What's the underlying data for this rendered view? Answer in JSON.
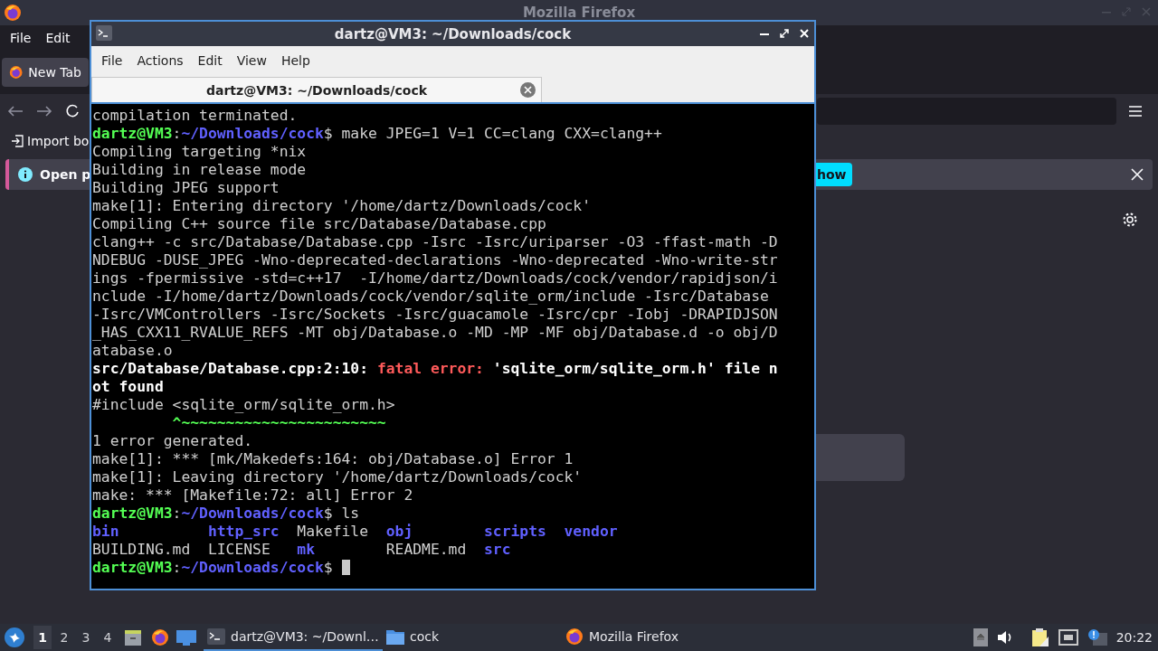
{
  "firefox": {
    "title": "Mozilla Firefox",
    "menu": [
      "File",
      "Edit"
    ],
    "tabs": [
      {
        "label": "New Tab",
        "selected": true
      }
    ],
    "bookmarks_item": "Import bo",
    "notification": {
      "text": "Open p",
      "button": "how"
    }
  },
  "terminal": {
    "title": "dartz@VM3: ~/Downloads/cock",
    "menu": [
      "File",
      "Actions",
      "Edit",
      "View",
      "Help"
    ],
    "tabs": [
      {
        "label": "dartz@VM3: ~/Downloads/cock",
        "selected": true
      }
    ],
    "cursor_visible": true,
    "lines": [
      [
        {
          "text": "compilation terminated.",
          "kind": "plain"
        }
      ],
      [
        {
          "text": "dartz@VM3",
          "kind": "user"
        },
        {
          "text": ":",
          "kind": "plain"
        },
        {
          "text": "~/Downloads/cock",
          "kind": "path"
        },
        {
          "text": "$ make JPEG=1 V=1 CC=clang CXX=clang++",
          "kind": "plain"
        }
      ],
      [
        {
          "text": "Compiling targeting *nix",
          "kind": "plain"
        }
      ],
      [
        {
          "text": "Building in release mode",
          "kind": "plain"
        }
      ],
      [
        {
          "text": "Building JPEG support",
          "kind": "plain"
        }
      ],
      [
        {
          "text": "make[1]: Entering directory '/home/dartz/Downloads/cock'",
          "kind": "plain"
        }
      ],
      [
        {
          "text": "Compiling C++ source file src/Database/Database.cpp",
          "kind": "plain"
        }
      ],
      [
        {
          "text": "clang++ -c src/Database/Database.cpp -Isrc -Isrc/uriparser -O3 -ffast-math -D",
          "kind": "plain"
        }
      ],
      [
        {
          "text": "NDEBUG -DUSE_JPEG -Wno-deprecated-declarations -Wno-deprecated -Wno-write-str",
          "kind": "plain"
        }
      ],
      [
        {
          "text": "ings -fpermissive -std=c++17  -I/home/dartz/Downloads/cock/vendor/rapidjson/i",
          "kind": "plain"
        }
      ],
      [
        {
          "text": "nclude -I/home/dartz/Downloads/cock/vendor/sqlite_orm/include -Isrc/Database",
          "kind": "plain"
        }
      ],
      [
        {
          "text": "-Isrc/VMControllers -Isrc/Sockets -Isrc/guacamole -Isrc/cpr -Iobj -DRAPIDJSON",
          "kind": "plain"
        }
      ],
      [
        {
          "text": "_HAS_CXX11_RVALUE_REFS -MT obj/Database.o -MD -MP -MF obj/Database.d -o obj/D",
          "kind": "plain"
        }
      ],
      [
        {
          "text": "atabase.o",
          "kind": "plain"
        }
      ],
      [
        {
          "text": "src/Database/Database.cpp:2:10: ",
          "kind": "bold"
        },
        {
          "text": "fatal error:",
          "kind": "error"
        },
        {
          "text": " 'sqlite_orm/sqlite_orm.h' file n",
          "kind": "bold"
        }
      ],
      [
        {
          "text": "ot found",
          "kind": "bold"
        }
      ],
      [
        {
          "text": "#include <sqlite_orm/sqlite_orm.h>",
          "kind": "plain"
        }
      ],
      [
        {
          "text": "         ^~~~~~~~~~~~~~~~~~~~~~~~",
          "kind": "caret"
        }
      ],
      [
        {
          "text": "1 error generated.",
          "kind": "plain"
        }
      ],
      [
        {
          "text": "make[1]: *** [mk/Makedefs:164: obj/Database.o] Error 1",
          "kind": "plain"
        }
      ],
      [
        {
          "text": "make[1]: Leaving directory '/home/dartz/Downloads/cock'",
          "kind": "plain"
        }
      ],
      [
        {
          "text": "make: *** [Makefile:72: all] Error 2",
          "kind": "plain"
        }
      ],
      [
        {
          "text": "dartz@VM3",
          "kind": "user"
        },
        {
          "text": ":",
          "kind": "plain"
        },
        {
          "text": "~/Downloads/cock",
          "kind": "path"
        },
        {
          "text": "$ ls",
          "kind": "plain"
        }
      ],
      [
        {
          "text": "bin          http_src  ",
          "kind": "dir"
        },
        {
          "text": "Makefile  ",
          "kind": "plain"
        },
        {
          "text": "obj        scripts  vendor",
          "kind": "dir"
        }
      ],
      [
        {
          "text": "BUILDING.md  LICENSE   ",
          "kind": "plain"
        },
        {
          "text": "mk        ",
          "kind": "dir"
        },
        {
          "text": "README.md  ",
          "kind": "plain"
        },
        {
          "text": "src",
          "kind": "dir"
        }
      ],
      [
        {
          "text": "dartz@VM3",
          "kind": "user"
        },
        {
          "text": ":",
          "kind": "plain"
        },
        {
          "text": "~/Downloads/cock",
          "kind": "path"
        },
        {
          "text": "$ ",
          "kind": "plain"
        }
      ]
    ]
  },
  "taskbar": {
    "desktops": [
      {
        "label": "1",
        "selected": true
      },
      {
        "label": "2",
        "selected": false
      },
      {
        "label": "3",
        "selected": false
      },
      {
        "label": "4",
        "selected": false
      }
    ],
    "tasks": [
      {
        "label": "dartz@VM3: ~/Downl…",
        "kind": "terminal",
        "selected": true
      },
      {
        "label": "cock",
        "kind": "folder",
        "selected": false
      },
      {
        "label": "Mozilla Firefox",
        "kind": "firefox",
        "selected": false
      }
    ],
    "clock": "20:22"
  }
}
